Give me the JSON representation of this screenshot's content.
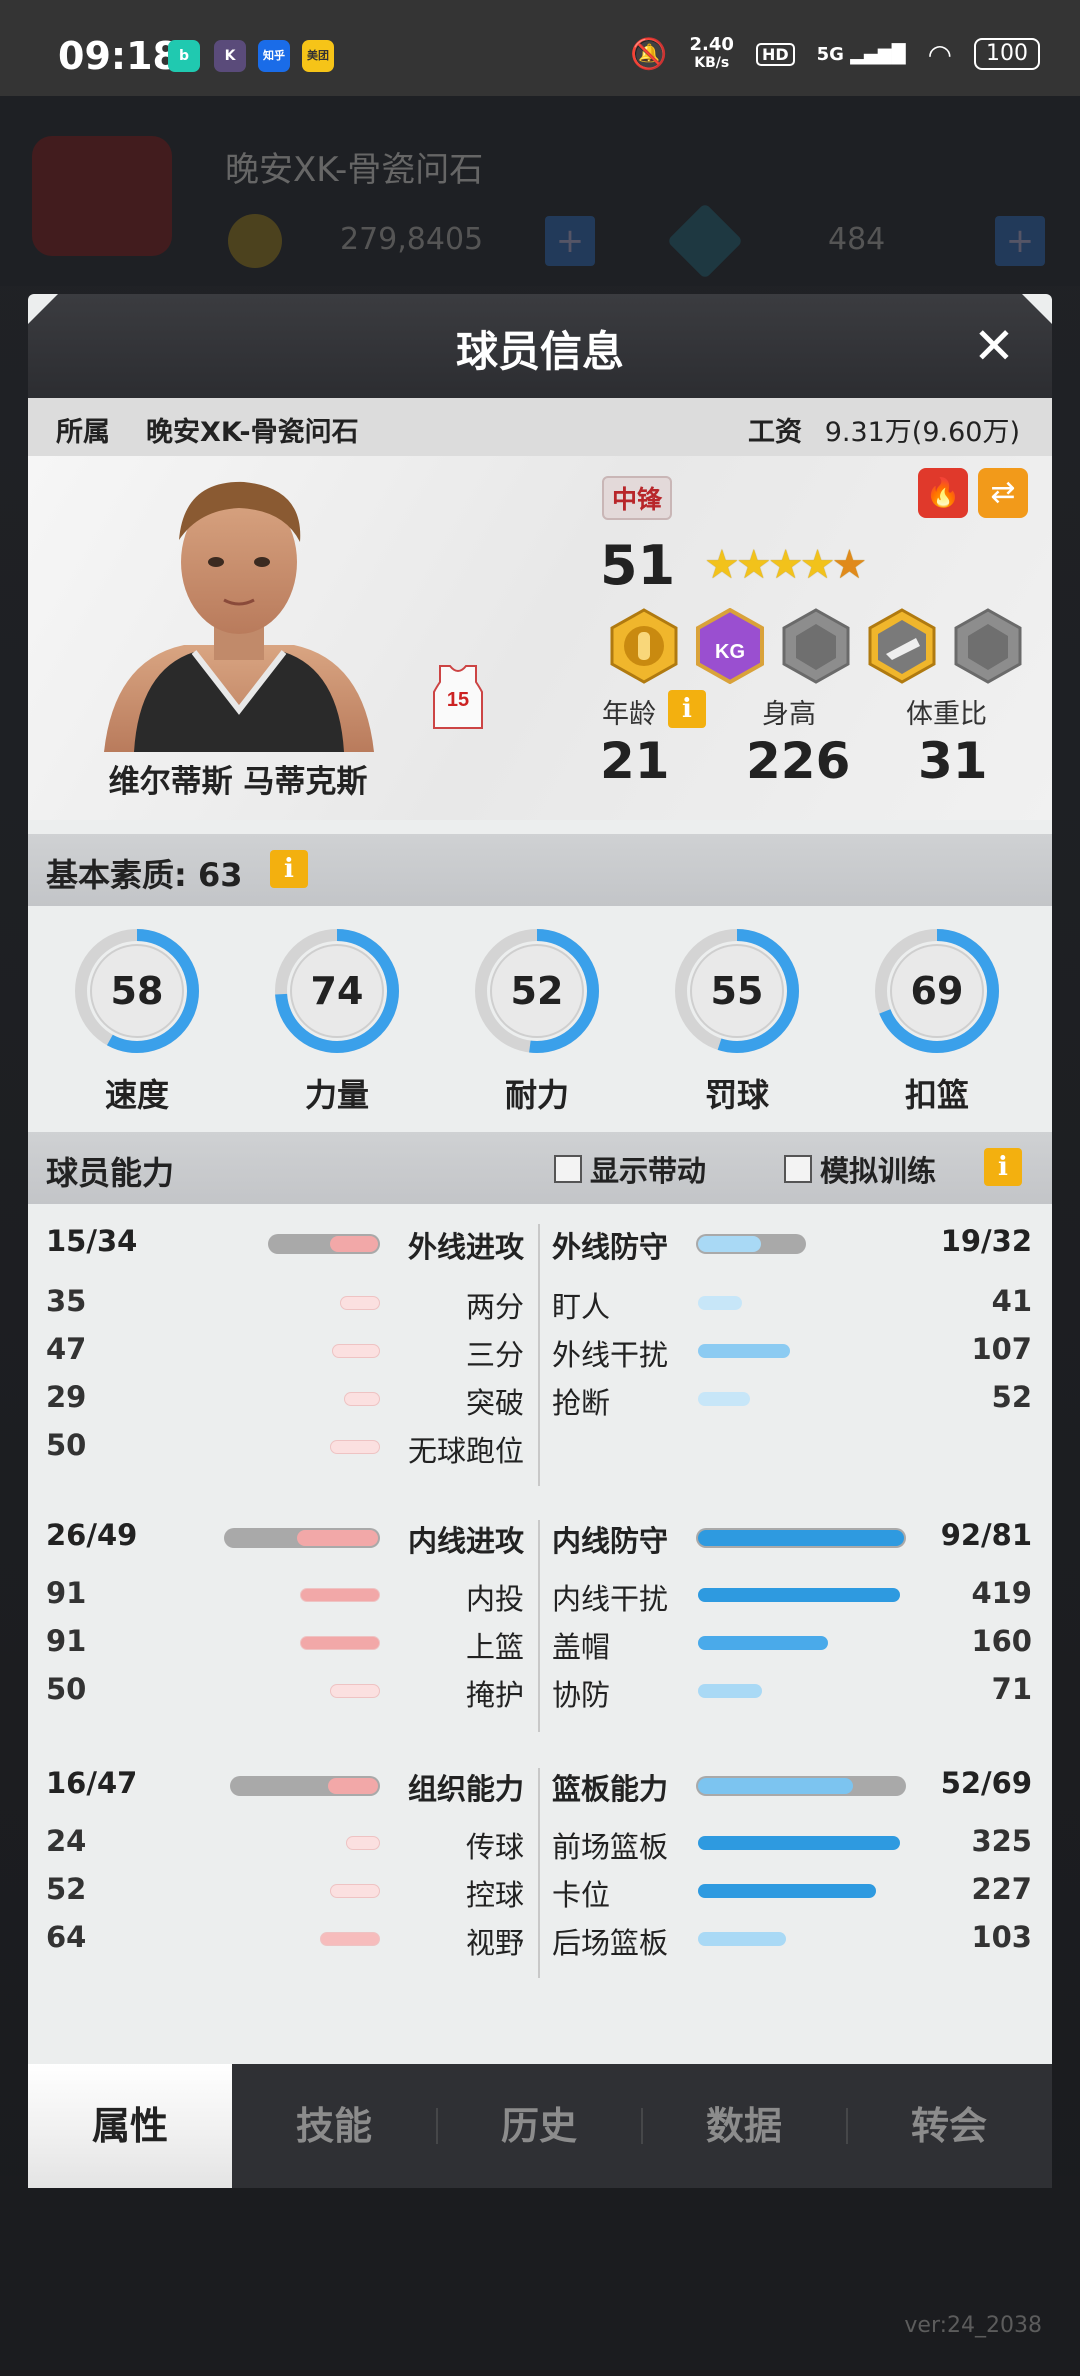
{
  "status_bar": {
    "time": "09:18",
    "apps": [
      {
        "name": "app-b",
        "letter": "b",
        "color": "#20c9b0"
      },
      {
        "name": "app-k",
        "letter": "K",
        "color": "#5a4b7a"
      },
      {
        "name": "app-zhihu",
        "letter": "知乎",
        "color": "#1a6ce8"
      },
      {
        "name": "app-meituan",
        "letter": "美团",
        "color": "#f6c418"
      }
    ],
    "net_rate": "2.40",
    "net_unit": "KB/s",
    "network": "5G",
    "hd": "HD",
    "battery": "100"
  },
  "background": {
    "team": "晚安XK-骨瓷问石",
    "coins": "279,8405",
    "gems": "484",
    "version": "ver:24_2038"
  },
  "modal": {
    "title": "球员信息",
    "close": "✕",
    "team_label": "所属",
    "team_name": "晚安XK-骨瓷问石",
    "salary_label": "工资",
    "salary_value": "9.31万(9.60万)"
  },
  "player": {
    "name": "维尔蒂斯 马蒂克斯",
    "position": "中锋",
    "overall": "51",
    "stars": 4.5,
    "jersey_number": "15",
    "badges": [
      "hand-badge",
      "kg-badge",
      "locked-badge",
      "shoe-badge",
      "locked-badge"
    ],
    "age_label": "年龄",
    "age": "21",
    "height_label": "身高",
    "height": "226",
    "weight_label": "体重比",
    "weight": "31",
    "info_icon": "i"
  },
  "base_stats": {
    "title": "基本素质: 63",
    "items": [
      {
        "label": "速度",
        "value": 58
      },
      {
        "label": "力量",
        "value": 74
      },
      {
        "label": "耐力",
        "value": 52
      },
      {
        "label": "罚球",
        "value": 55
      },
      {
        "label": "扣篮",
        "value": 69
      }
    ]
  },
  "abilities": {
    "title": "球员能力",
    "show_boost": "显示带动",
    "sim_training": "模拟训练",
    "categories": [
      {
        "left": {
          "name": "外线进攻",
          "score": "15/34",
          "level": 0.44
        },
        "right": {
          "name": "外线防守",
          "score": "19/32",
          "level": 0.59
        },
        "rows": [
          {
            "lname": "两分",
            "lval": "35",
            "rname": "盯人",
            "rval": "41"
          },
          {
            "lname": "三分",
            "lval": "47",
            "rname": "外线干扰",
            "rval": "107"
          },
          {
            "lname": "突破",
            "lval": "29",
            "rname": "抢断",
            "rval": "52"
          },
          {
            "lname": "无球跑位",
            "lval": "50",
            "rname": "",
            "rval": ""
          }
        ]
      },
      {
        "left": {
          "name": "内线进攻",
          "score": "26/49",
          "level": 0.53
        },
        "right": {
          "name": "内线防守",
          "score": "92/81",
          "level": 1.0
        },
        "rows": [
          {
            "lname": "内投",
            "lval": "91",
            "rname": "内线干扰",
            "rval": "419"
          },
          {
            "lname": "上篮",
            "lval": "91",
            "rname": "盖帽",
            "rval": "160"
          },
          {
            "lname": "掩护",
            "lval": "50",
            "rname": "协防",
            "rval": "71"
          }
        ]
      },
      {
        "left": {
          "name": "组织能力",
          "score": "16/47",
          "level": 0.34
        },
        "right": {
          "name": "篮板能力",
          "score": "52/69",
          "level": 0.75
        },
        "rows": [
          {
            "lname": "传球",
            "lval": "24",
            "rname": "前场篮板",
            "rval": "325"
          },
          {
            "lname": "控球",
            "lval": "52",
            "rname": "卡位",
            "rval": "227"
          },
          {
            "lname": "视野",
            "lval": "64",
            "rname": "后场篮板",
            "rval": "103"
          }
        ]
      }
    ]
  },
  "tabs": [
    {
      "label": "属性",
      "active": true
    },
    {
      "label": "技能",
      "active": false
    },
    {
      "label": "历史",
      "active": false
    },
    {
      "label": "数据",
      "active": false
    },
    {
      "label": "转会",
      "active": false
    }
  ],
  "colors": {
    "gauge_blue": "#3aa0ea",
    "bar_red": "#f2a8a8",
    "bar_blue_strong": "#2e9ae0",
    "bar_blue_light": "#a9d9f5",
    "info_orange": "#f3b00f"
  }
}
